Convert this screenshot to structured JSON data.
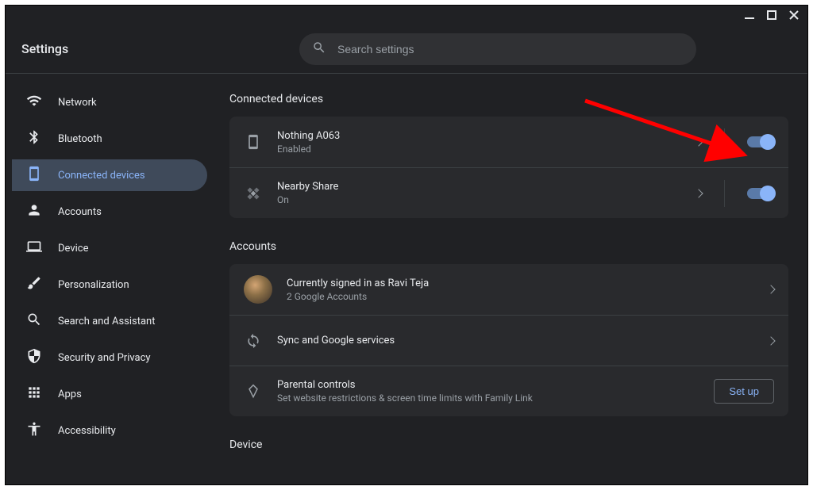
{
  "window": {
    "title": "Settings"
  },
  "search": {
    "placeholder": "Search settings"
  },
  "sidebar": {
    "items": [
      {
        "label": "Network",
        "icon": "wifi"
      },
      {
        "label": "Bluetooth",
        "icon": "bluetooth"
      },
      {
        "label": "Connected devices",
        "icon": "device",
        "active": true
      },
      {
        "label": "Accounts",
        "icon": "person"
      },
      {
        "label": "Device",
        "icon": "laptop"
      },
      {
        "label": "Personalization",
        "icon": "brush"
      },
      {
        "label": "Search and Assistant",
        "icon": "search"
      },
      {
        "label": "Security and Privacy",
        "icon": "shield"
      },
      {
        "label": "Apps",
        "icon": "apps"
      },
      {
        "label": "Accessibility",
        "icon": "accessibility"
      }
    ]
  },
  "sections": {
    "connected": {
      "heading": "Connected devices",
      "phone": {
        "title": "Nothing A063",
        "sub": "Enabled"
      },
      "nearby": {
        "title": "Nearby Share",
        "sub": "On"
      }
    },
    "accounts": {
      "heading": "Accounts",
      "signed_in": {
        "title": "Currently signed in as Ravi Teja",
        "sub": "2 Google Accounts"
      },
      "sync": {
        "title": "Sync and Google services"
      },
      "parental": {
        "title": "Parental controls",
        "sub": "Set website restrictions & screen time limits with Family Link",
        "button": "Set up"
      }
    },
    "device": {
      "heading": "Device"
    }
  },
  "colors": {
    "accent": "#8ab4f8",
    "bg": "#202124",
    "card": "#292a2d"
  }
}
